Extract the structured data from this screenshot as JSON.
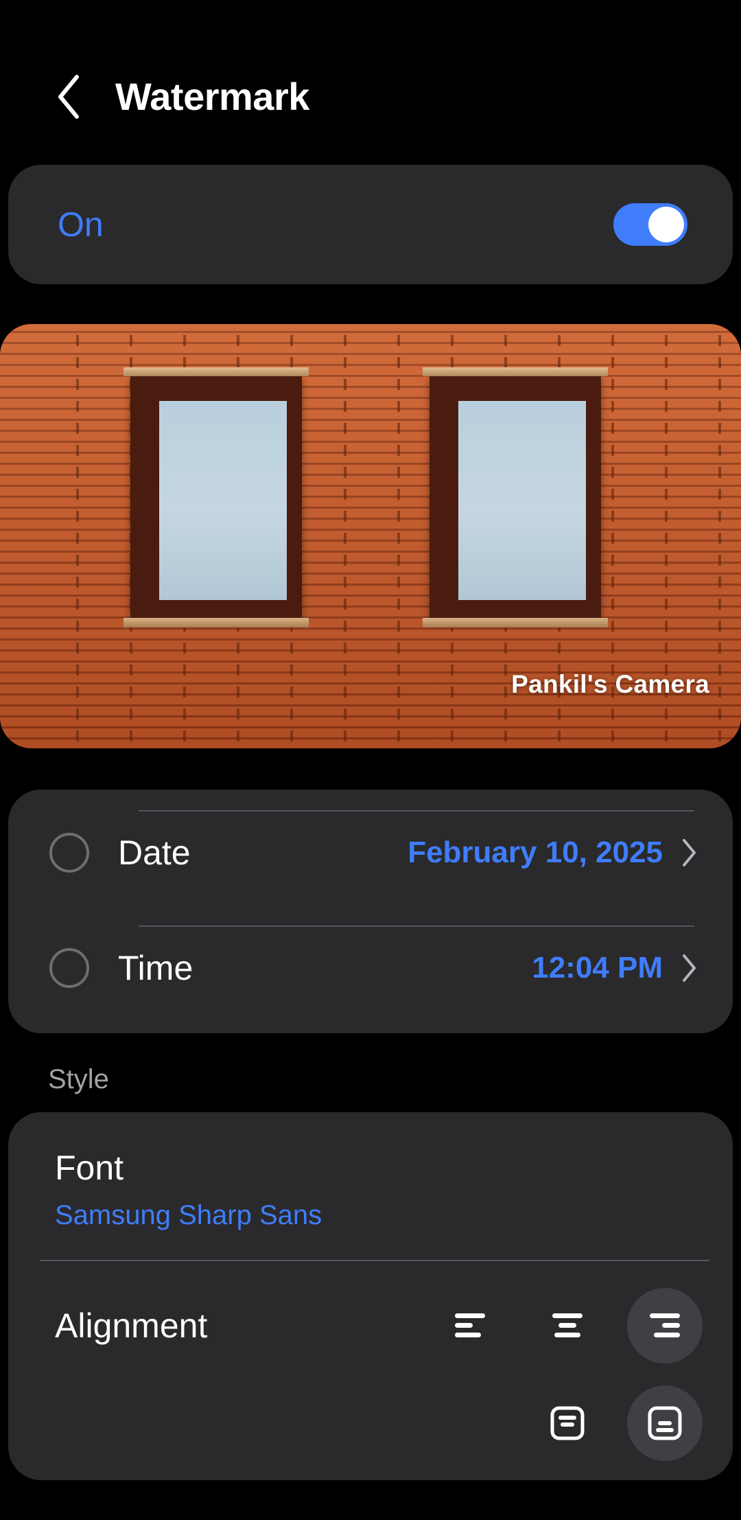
{
  "header": {
    "back_icon": "chevron-left-icon",
    "title": "Watermark"
  },
  "toggle": {
    "label": "On",
    "state": "on",
    "accent_color": "#3f7dfb"
  },
  "preview": {
    "watermark_text": "Pankil's Camera",
    "image_description": "brick-wall-with-two-windows"
  },
  "options": {
    "rows": [
      {
        "label": "Date",
        "value": "February 10, 2025",
        "checked": false,
        "chevron": "chevron-right-icon"
      },
      {
        "label": "Time",
        "value": "12:04 PM",
        "checked": false,
        "chevron": "chevron-right-icon"
      }
    ]
  },
  "style": {
    "section_title": "Style",
    "font_label": "Font",
    "font_value": "Samsung Sharp Sans",
    "alignment_label": "Alignment",
    "alignment_options": [
      {
        "name": "align-left-icon",
        "selected": false
      },
      {
        "name": "align-center-icon",
        "selected": false
      },
      {
        "name": "align-right-icon",
        "selected": true
      }
    ],
    "position_options": [
      {
        "name": "position-top-icon",
        "selected": false
      },
      {
        "name": "position-bottom-icon",
        "selected": true
      }
    ]
  },
  "colors": {
    "background": "#000000",
    "card": "#2a2a2c",
    "accent_blue": "#3f7dfb",
    "secondary_text": "#a2a2a6",
    "divider": "#55565a"
  }
}
